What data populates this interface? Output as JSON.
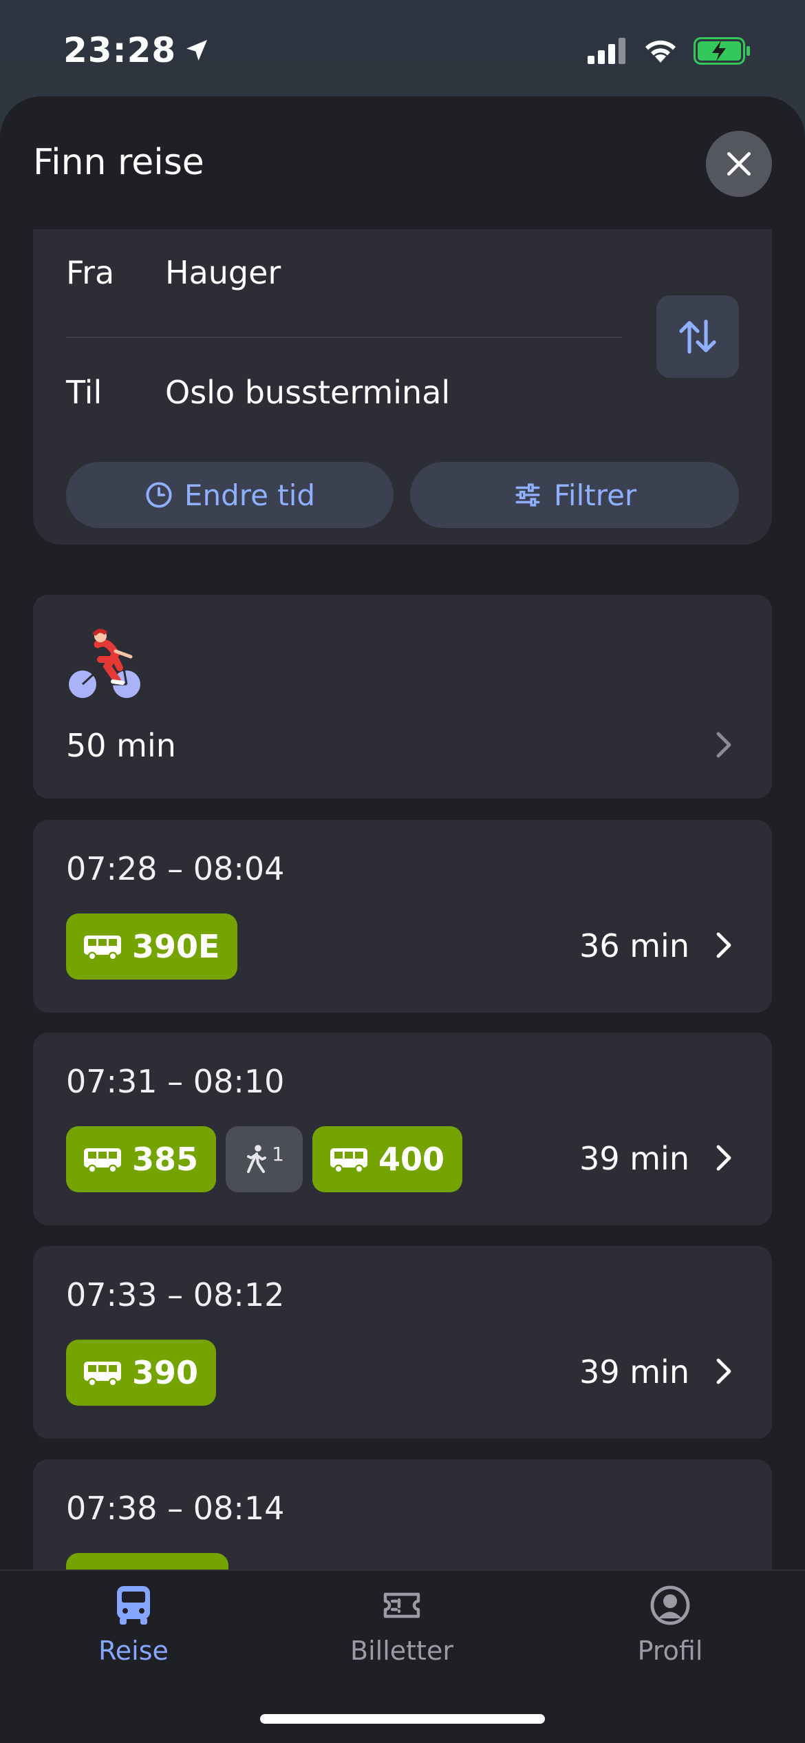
{
  "status_bar": {
    "time": "23:28",
    "location_icon": "location-arrow-icon",
    "signal_icon": "cellular-signal-icon",
    "wifi_icon": "wifi-icon",
    "battery_icon": "battery-charging-icon"
  },
  "header": {
    "title": "Finn reise",
    "close_icon": "close-icon"
  },
  "search": {
    "from_label": "Fra",
    "from_value": "Hauger",
    "to_label": "Til",
    "to_value": "Oslo bussterminal",
    "swap_icon": "swap-arrows-icon",
    "change_time_label": "Endre tid",
    "change_time_icon": "clock-icon",
    "filter_label": "Filtrer",
    "filter_icon": "sliders-icon"
  },
  "bike_option": {
    "duration": "50 min",
    "icon": "cyclist-illustration"
  },
  "trips": [
    {
      "time_range": "07:28 – 08:04",
      "legs": [
        {
          "type": "bus",
          "line": "390E"
        }
      ],
      "duration": "36 min"
    },
    {
      "time_range": "07:31 – 08:10",
      "legs": [
        {
          "type": "bus",
          "line": "385"
        },
        {
          "type": "walk",
          "count": "1"
        },
        {
          "type": "bus",
          "line": "400"
        }
      ],
      "duration": "39 min"
    },
    {
      "time_range": "07:33 – 08:12",
      "legs": [
        {
          "type": "bus",
          "line": "390"
        }
      ],
      "duration": "39 min"
    },
    {
      "time_range": "07:38 – 08:14"
    }
  ],
  "tab_bar": {
    "tabs": [
      {
        "label": "Reise",
        "icon": "bus-icon",
        "active": true
      },
      {
        "label": "Billetter",
        "icon": "ticket-icon",
        "active": false
      },
      {
        "label": "Profil",
        "icon": "profile-icon",
        "active": false
      }
    ]
  },
  "colors": {
    "accent": "#86a6ff",
    "bus_green": "#75a300",
    "card": "#2c2d35",
    "sheet": "#1f2026"
  }
}
